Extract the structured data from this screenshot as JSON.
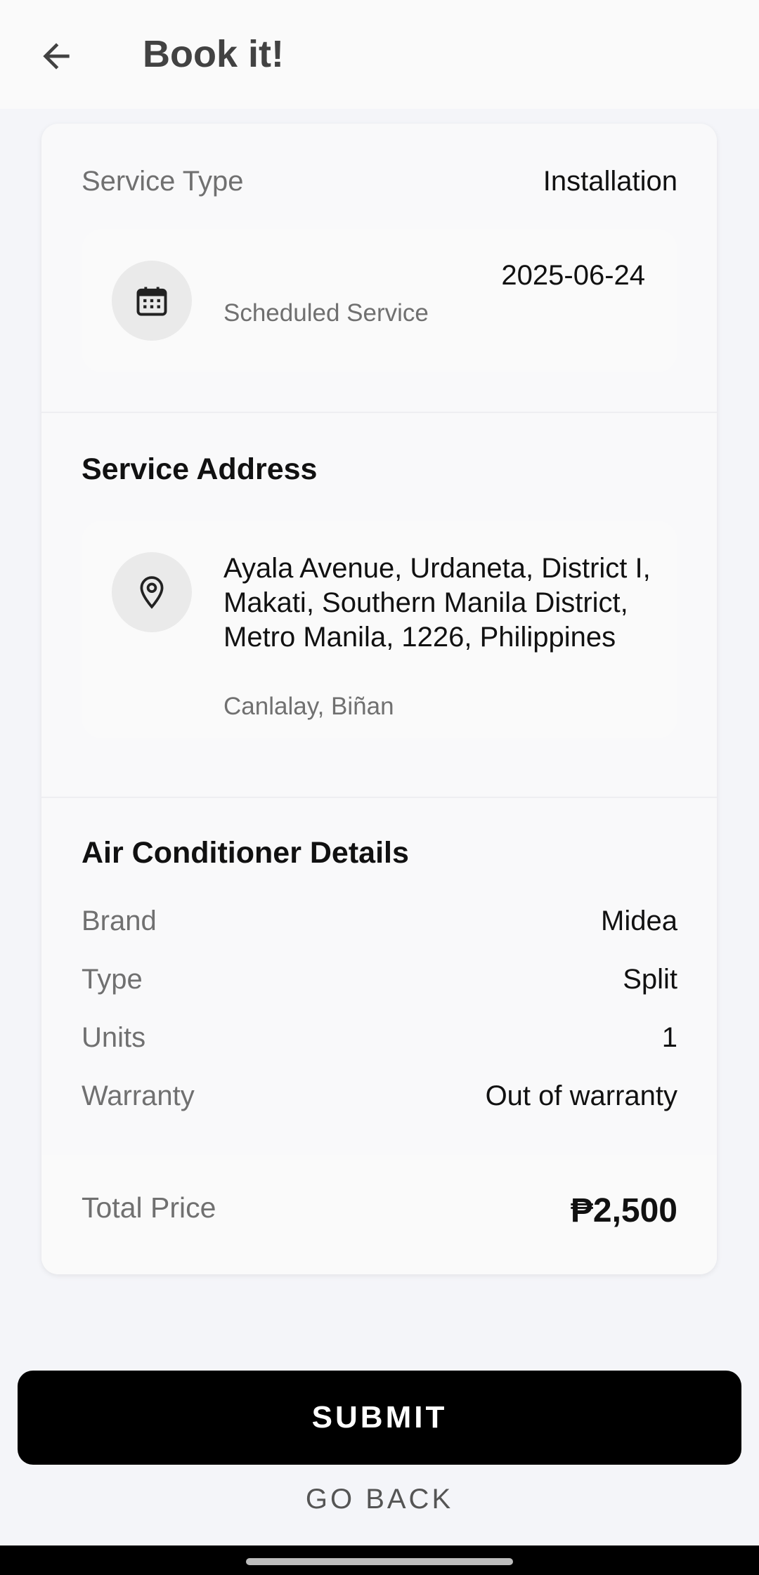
{
  "header": {
    "title": "Book it!"
  },
  "service": {
    "type_label": "Service Type",
    "type_value": "Installation",
    "date": "2025-06-24",
    "scheduled_label": "Scheduled Service"
  },
  "address": {
    "heading": "Service Address",
    "main": "Ayala Avenue, Urdaneta, District I, Makati, Southern Manila District, Metro Manila, 1226, Philippines",
    "sub": "Canlalay, Biñan"
  },
  "ac": {
    "heading": "Air Conditioner Details",
    "rows": [
      {
        "label": "Brand",
        "value": "Midea"
      },
      {
        "label": "Type",
        "value": "Split"
      },
      {
        "label": "Units",
        "value": "1"
      },
      {
        "label": "Warranty",
        "value": "Out of warranty"
      }
    ]
  },
  "price": {
    "label": "Total Price",
    "value": "₱2,500"
  },
  "actions": {
    "submit": "SUBMIT",
    "go_back": "GO BACK"
  },
  "icons": {
    "back": "arrow-left-icon",
    "calendar": "calendar-icon",
    "location": "map-pin-icon"
  }
}
